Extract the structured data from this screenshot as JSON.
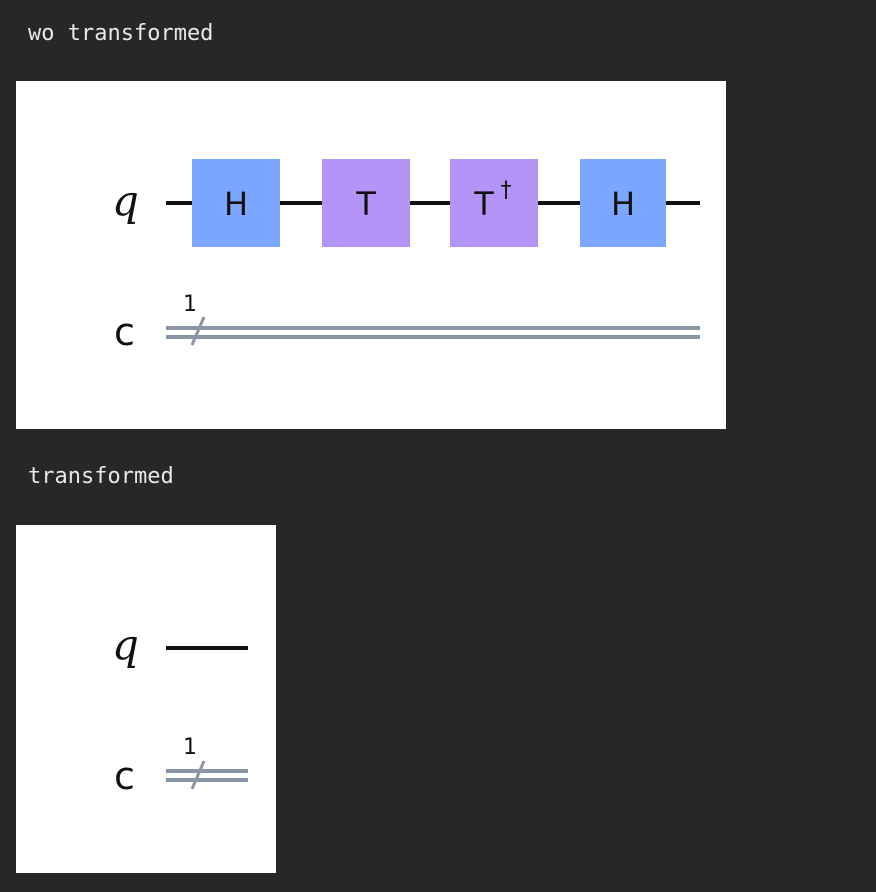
{
  "cells": [
    {
      "caption": "wo transformed",
      "circuit": {
        "quantum_register": "q",
        "classical_register": "c",
        "classical_width": "1",
        "gates": [
          {
            "name": "H",
            "sup": "",
            "color": "#7ca6ff"
          },
          {
            "name": "T",
            "sup": "",
            "color": "#b594f7"
          },
          {
            "name": "T",
            "sup": "†",
            "color": "#b594f7"
          },
          {
            "name": "H",
            "sup": "",
            "color": "#7ca6ff"
          }
        ]
      }
    },
    {
      "caption": "transformed",
      "circuit": {
        "quantum_register": "q",
        "classical_register": "c",
        "classical_width": "1",
        "gates": []
      }
    }
  ],
  "colors": {
    "background": "#272727",
    "caption_text": "#e8e8e8",
    "figure_background": "#ffffff",
    "quantum_wire": "#111111",
    "classical_wire": "#8a96a6",
    "hadamard_gate": "#7ca6ff",
    "t_gate": "#b594f7"
  }
}
